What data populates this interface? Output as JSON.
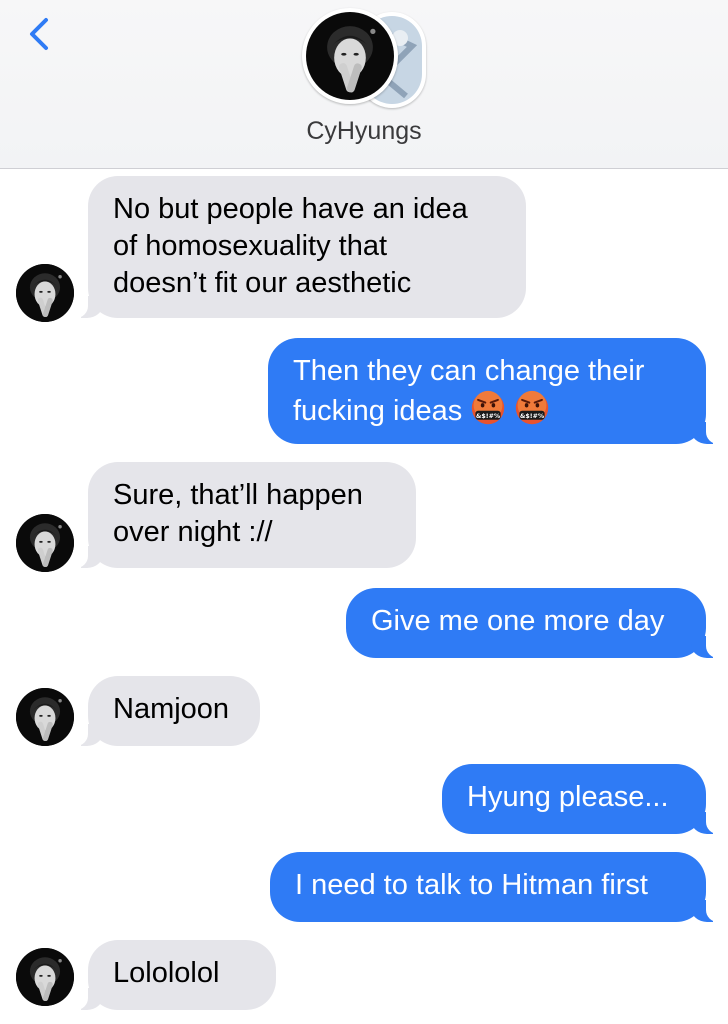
{
  "header": {
    "contact_name": "CyHyungs",
    "back_icon": "chevron-left-icon"
  },
  "colors": {
    "incoming_bubble": "#e5e5ea",
    "outgoing_bubble": "#2f7bf5",
    "accent": "#2f7bf5"
  },
  "messages": [
    {
      "direction": "incoming",
      "text": "No but people have an idea\nof homosexuality that\ndoesn’t fit our aesthetic"
    },
    {
      "direction": "outgoing",
      "text": "Then they can change their\nfucking ideas",
      "emojis": [
        "face-with-symbols-on-mouth",
        "face-with-symbols-on-mouth"
      ]
    },
    {
      "direction": "incoming",
      "text": "Sure, that’ll happen\nover night ://"
    },
    {
      "direction": "outgoing",
      "text": "Give me one more day"
    },
    {
      "direction": "incoming",
      "text": "Namjoon"
    },
    {
      "direction": "outgoing",
      "text": "Hyung please..."
    },
    {
      "direction": "outgoing",
      "text": "I need to talk to Hitman first"
    },
    {
      "direction": "incoming",
      "text": "Lolololol"
    }
  ]
}
